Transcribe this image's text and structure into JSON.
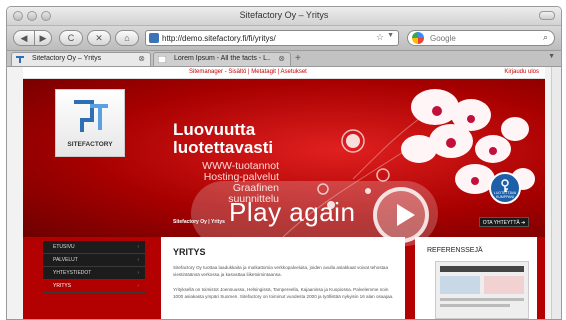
{
  "window": {
    "title": "Sitefactory Oy – Yritys"
  },
  "toolbar": {
    "back_label": "◀",
    "forward_label": "▶",
    "reload_label": "C",
    "stop_label": "✕",
    "home_label": "⌂",
    "url": "http://demo.sitefactory.fi/fi/yritys/",
    "search_placeholder": "Google"
  },
  "tabs": [
    {
      "label": "Sitefactory Oy – Yritys",
      "active": true
    },
    {
      "label": "Lorem Ipsum - All the facts - L...",
      "active": false
    }
  ],
  "site": {
    "adminbar": {
      "links": "Sitemanager - Sisältö | Metatagit | Asetukset",
      "logout": "Kirjaudu ulos"
    },
    "logo_text": "SITEFACTORY",
    "headline_1": "Luovuutta",
    "headline_2": "luotettavasti",
    "services": [
      "WWW-tuotannot",
      "Hosting-palvelut",
      "Graafinen suunnittelu"
    ],
    "tagline": "Sitefactory Oy | Yritys",
    "cta": "OTA YHTEYTTÄ ➜",
    "badge_text": "LUOTETTAVA KUMPPANI",
    "nav": [
      {
        "label": "ETUSIVU",
        "active": false
      },
      {
        "label": "PALVELUT",
        "active": false
      },
      {
        "label": "YHTEYSTIEDOT",
        "active": false
      },
      {
        "label": "YRITYS",
        "active": true
      }
    ],
    "content": {
      "title": "YRITYS",
      "p1": "Sitefactory Oy tuottaa laadukkaita ja mutkattomia verkkopalveluita, joiden avulla asiakkaat voivat tehostaa viestintäänsä verkossa ja kasvattaa liiketoimintaansa.",
      "p2": "Yrityksellä on toimistot Joensuussa, Helsingissä, Tampereella, Kajaanissa ja Kuopiossa. Palvelemme noin 1000 asiakasta ympäri Suomen. Sitefactory on toiminut vuodesta 2000 ja työllistää nykyisin 16 alan osaajaa."
    },
    "references_title": "REFERENSSEJÄ"
  },
  "overlay": {
    "play_label": "Play again"
  },
  "colors": {
    "brand_red": "#b30000",
    "logo_blue": "#2f6db5"
  }
}
